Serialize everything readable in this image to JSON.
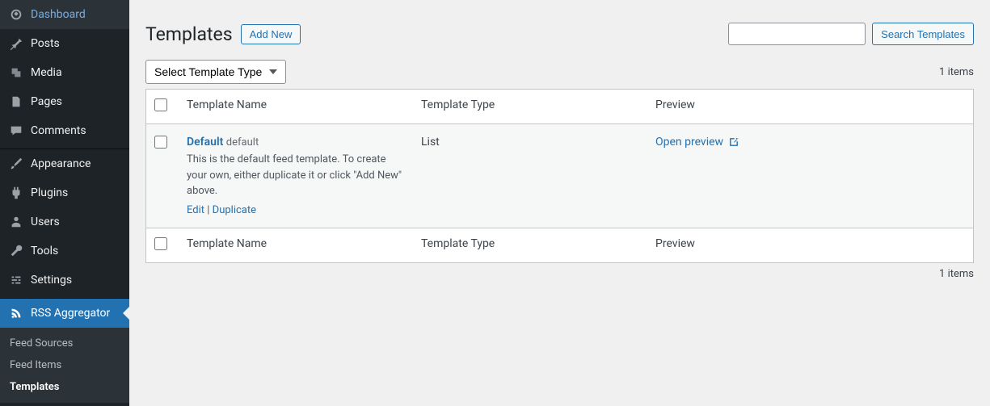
{
  "sidebar": {
    "items": [
      {
        "label": "Dashboard"
      },
      {
        "label": "Posts"
      },
      {
        "label": "Media"
      },
      {
        "label": "Pages"
      },
      {
        "label": "Comments"
      },
      {
        "label": "Appearance"
      },
      {
        "label": "Plugins"
      },
      {
        "label": "Users"
      },
      {
        "label": "Tools"
      },
      {
        "label": "Settings"
      },
      {
        "label": "RSS Aggregator"
      }
    ],
    "submenu": [
      {
        "label": "Feed Sources"
      },
      {
        "label": "Feed Items"
      },
      {
        "label": "Templates"
      }
    ]
  },
  "header": {
    "title": "Templates",
    "add_new_label": "Add New",
    "search_button_label": "Search Templates"
  },
  "filters": {
    "template_type_select": "Select Template Type",
    "item_count": "1 items"
  },
  "table": {
    "columns": {
      "name": "Template Name",
      "type": "Template Type",
      "preview": "Preview"
    },
    "rows": [
      {
        "name": "Default",
        "slug": "default",
        "description": "This is the default feed template. To create your own, either duplicate it or click \"Add New\" above.",
        "type": "List",
        "preview_label": "Open preview",
        "actions": {
          "edit": "Edit",
          "duplicate": "Duplicate"
        }
      }
    ]
  },
  "footer": {
    "item_count": "1 items"
  }
}
